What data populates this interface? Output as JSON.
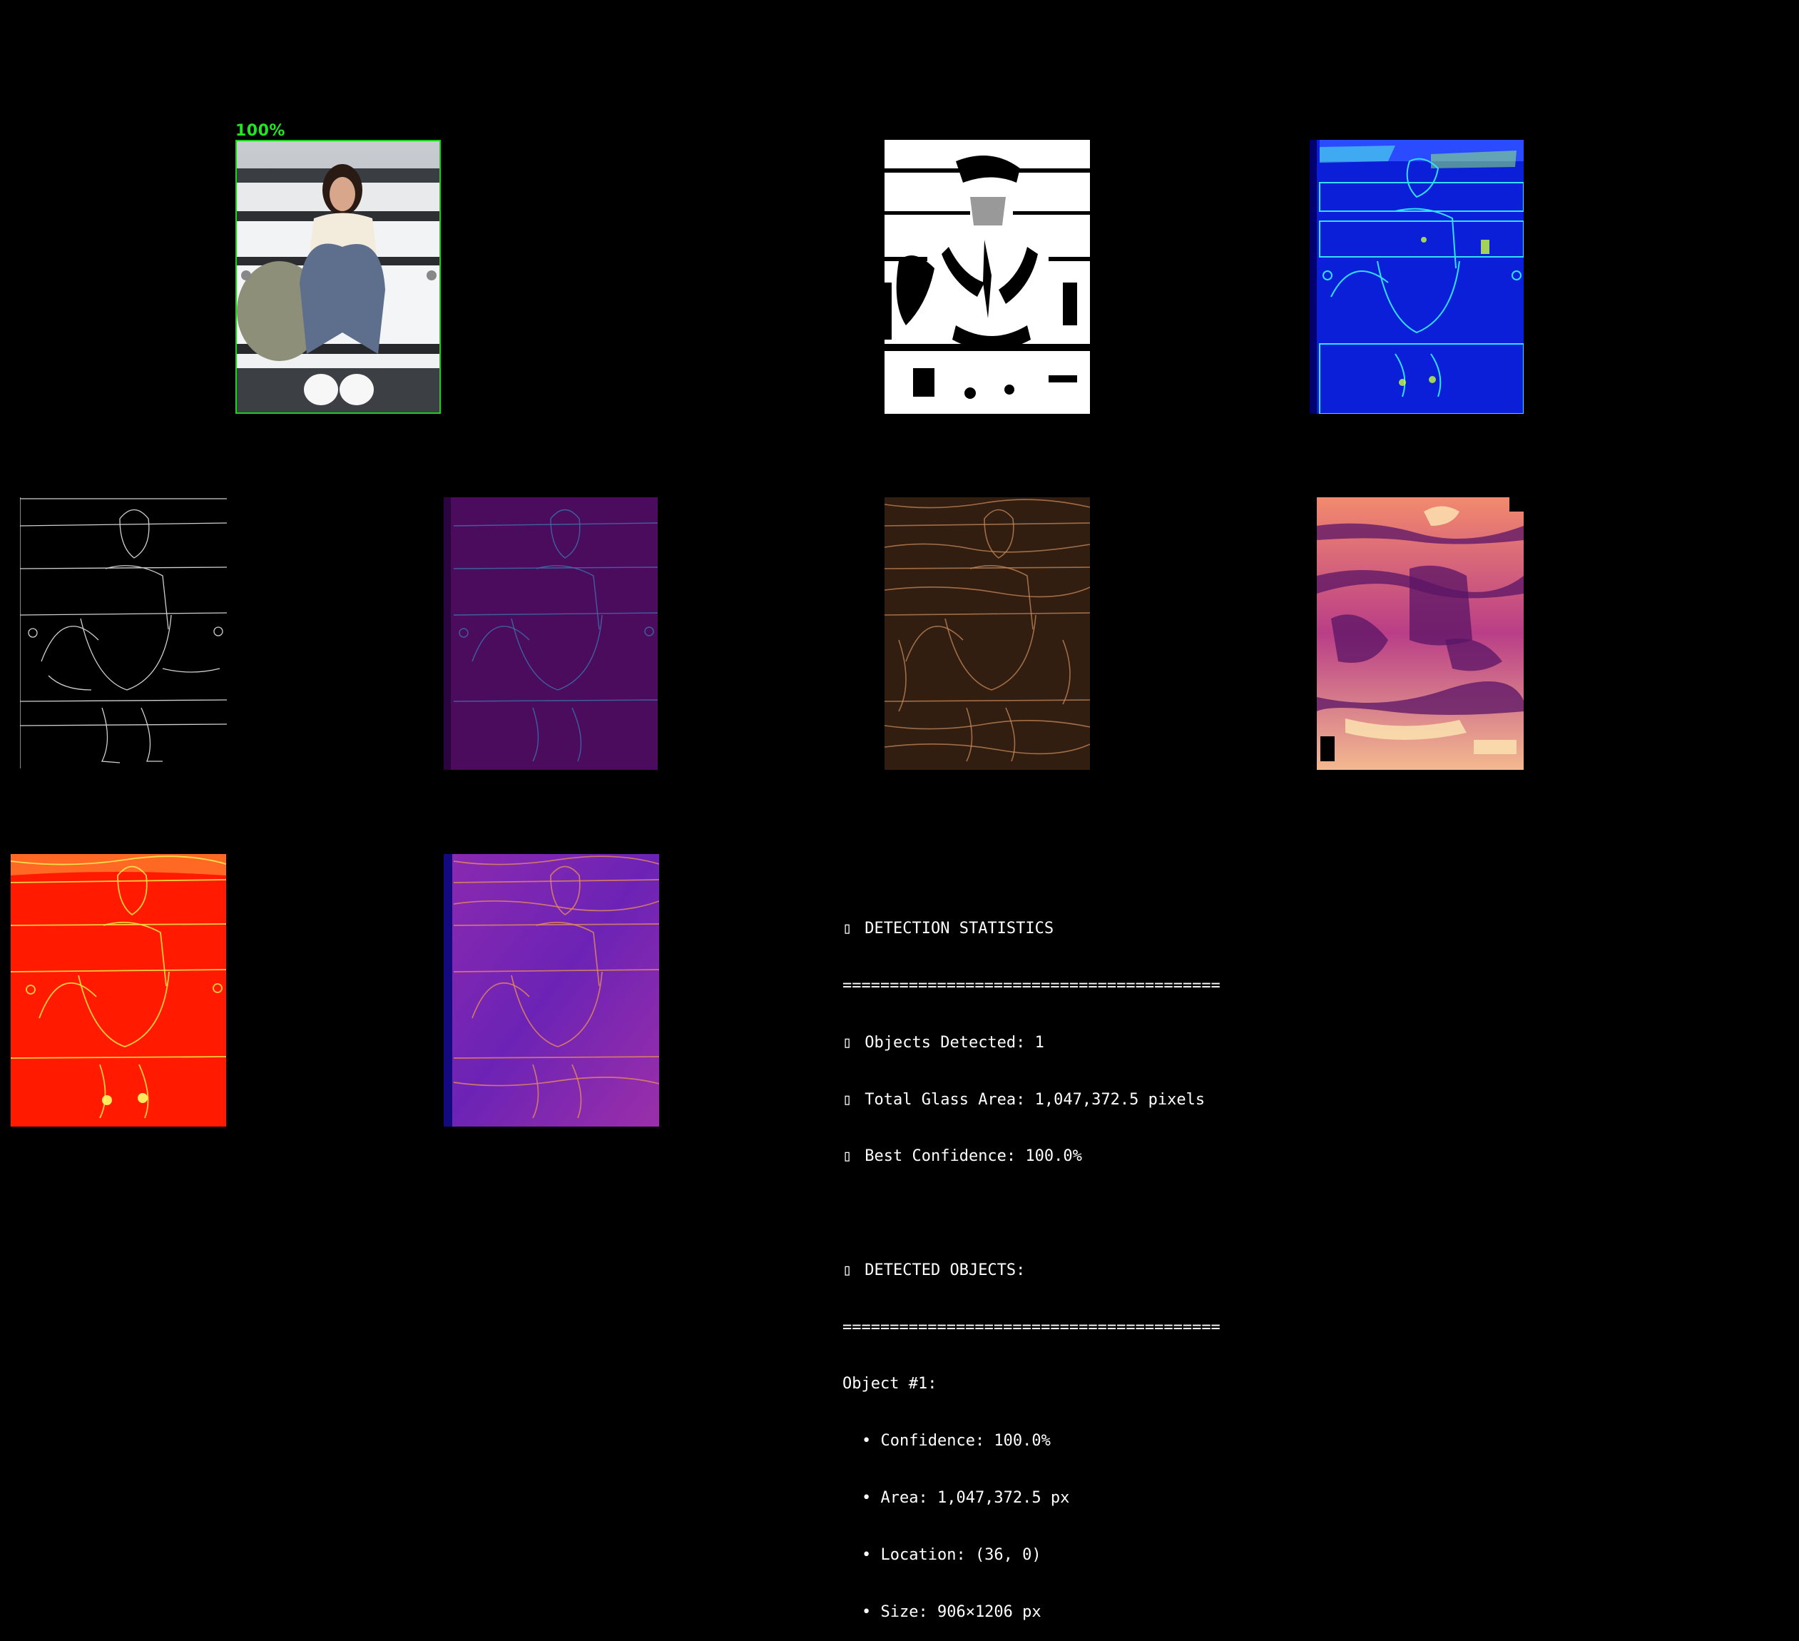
{
  "detection": {
    "label": "100%",
    "box_color": "#1fd11f"
  },
  "stats": {
    "header_icon": "chart-icon",
    "header": "DETECTION STATISTICS",
    "separator": "========================================",
    "objects_icon": "search-icon",
    "objects_detected": "Objects Detected: 1",
    "area_icon": "ruler-icon",
    "total_area": "Total Glass Area: 1,047,372.5 pixels",
    "conf_icon": "target-icon",
    "best_confidence": "Best Confidence: 100.0%",
    "objects_header_icon": "list-icon",
    "objects_header": "DETECTED OBJECTS:",
    "separator2": "========================================",
    "object_title": "Object #1:",
    "obj_confidence": "• Confidence: 100.0%",
    "obj_area": "• Area: 1,047,372.5 px",
    "obj_location": "• Location: (36, 0)",
    "obj_size": "• Size: 906×1206 px"
  },
  "colors": {
    "background": "#000000",
    "text": "#ffffff",
    "accent_green": "#1fd11f"
  }
}
